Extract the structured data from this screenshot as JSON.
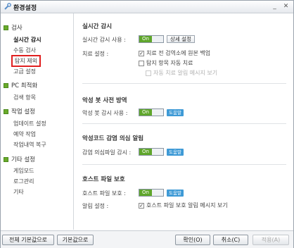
{
  "window": {
    "title": "환경설정",
    "minimize": "_",
    "close": "✕"
  },
  "sidebar": {
    "categories": [
      {
        "label": "검사",
        "items": [
          "실시간 감시",
          "수동 검사",
          "탐지 제외",
          "고급 설정"
        ]
      },
      {
        "label": "PC 최적화",
        "items": [
          "검색 항목"
        ]
      },
      {
        "label": "작업 설정",
        "items": [
          "업데이트 설정",
          "예약 작업",
          "작업내역 복구"
        ]
      },
      {
        "label": "기타 설정",
        "items": [
          "게임모드",
          "로그관리",
          "기타"
        ]
      }
    ]
  },
  "realtime": {
    "title": "실시간 감시",
    "use_label": "실시간 감시 사용 :",
    "toggle": "On",
    "detail_button": "상세 설정",
    "treat_label": "치료 설정 :",
    "opt_backup": "치료 전 검역소에 원본 백업",
    "opt_auto": "탐지 항목 자동 치료",
    "opt_alert": "자동 치료 알림 메시지 보기",
    "opt_backup_checked": "✓"
  },
  "malware": {
    "title": "악성 봇 사전 방역",
    "use_label": "악성 봇 감시 사용 :",
    "toggle": "On",
    "help": "도움말"
  },
  "malcode": {
    "title": "악성코드 감염 의심 알림",
    "use_label": "감염 의심파일 감시 :",
    "toggle": "On",
    "help": "도움말"
  },
  "hosts": {
    "title": "호스트 파일 보호",
    "use_label": "호스트 파일 보호 :",
    "toggle": "On",
    "help": "도움말",
    "alert_label": "알림 설정 :",
    "opt_alert": "호스트 파일 보호 알림 메시지 보기",
    "opt_alert_checked": "✓"
  },
  "footer": {
    "reset_all": "전체 기본값으로",
    "reset": "기본값으로",
    "ok": "확인(O)",
    "cancel": "취소(C)",
    "apply": "적용(A)"
  },
  "colors": {
    "accent_green": "#5fa62b",
    "help_blue": "#3e9ad6",
    "highlight_red": "#e02020"
  }
}
